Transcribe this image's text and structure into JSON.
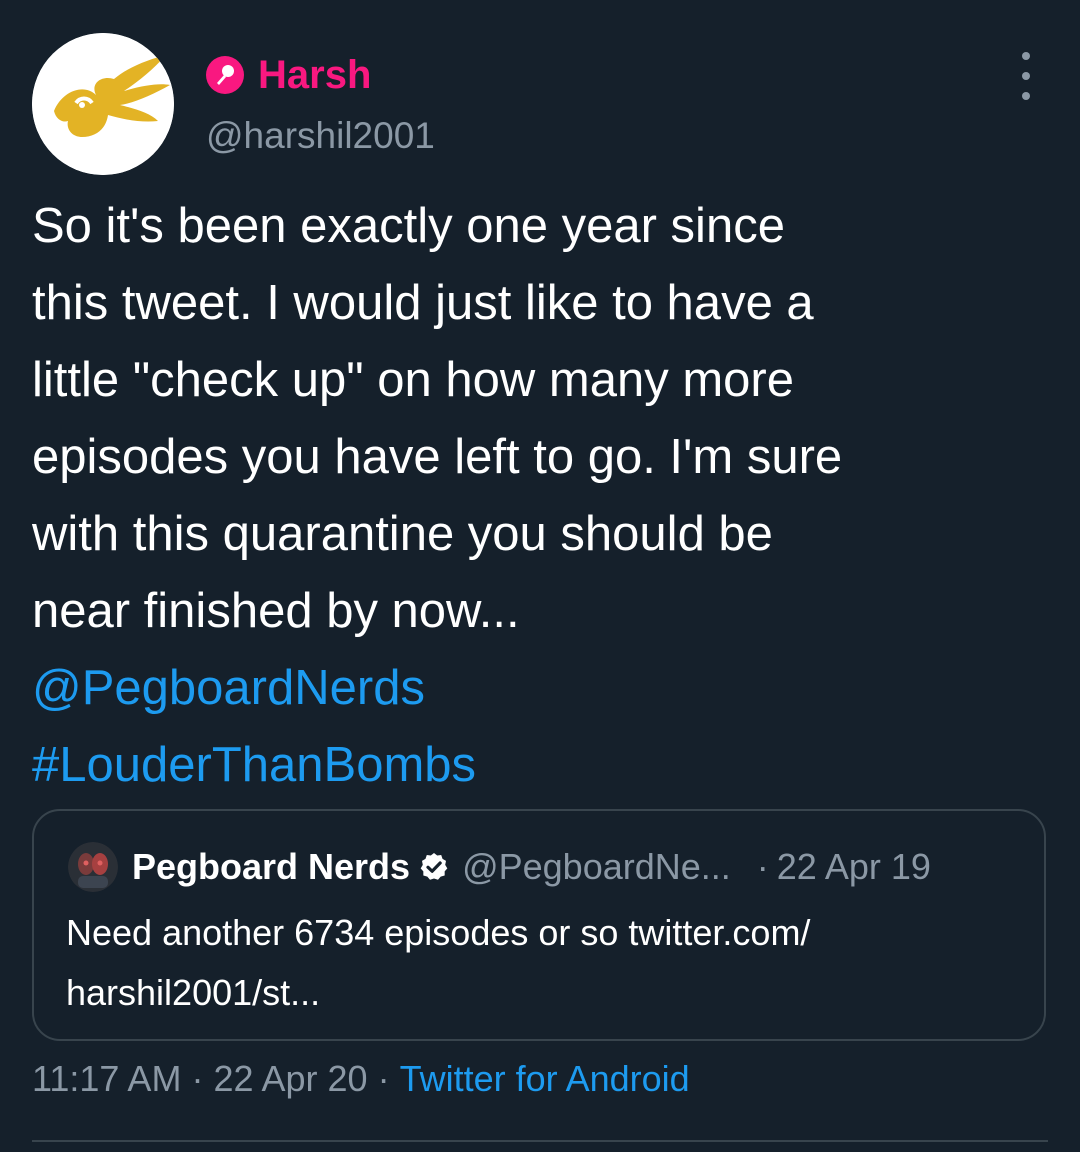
{
  "author": {
    "display_name": "Harsh",
    "handle": "@harshil2001",
    "avatar_icon": "yellow-bird-logo",
    "badge_icon": "microphone-icon"
  },
  "tweet": {
    "lines": [
      "So it's been exactly one year since",
      "this tweet. I would just like to have a",
      "little \"check up\" on how many more",
      "episodes you have left to go. I'm sure",
      "with this quarantine you should be",
      "near finished by now..."
    ],
    "mention": "@PegboardNerds",
    "hashtag": "#LouderThanBombs"
  },
  "quoted_tweet": {
    "display_name": "Pegboard Nerds",
    "handle": "@PegboardNe...",
    "separator": "·",
    "date": "22 Apr 19",
    "text_line_1": "Need another 6734 episodes or so twitter.com/",
    "text_line_2": "harshil2001/st..."
  },
  "meta": {
    "time": "11:17 AM",
    "separator": "·",
    "date": "22 Apr 20",
    "source": "Twitter for Android"
  },
  "colors": {
    "background": "#15202b",
    "name_pink": "#f91880",
    "link_blue": "#1d9bf0",
    "muted_gray": "#8b98a5",
    "border": "#38444d"
  }
}
